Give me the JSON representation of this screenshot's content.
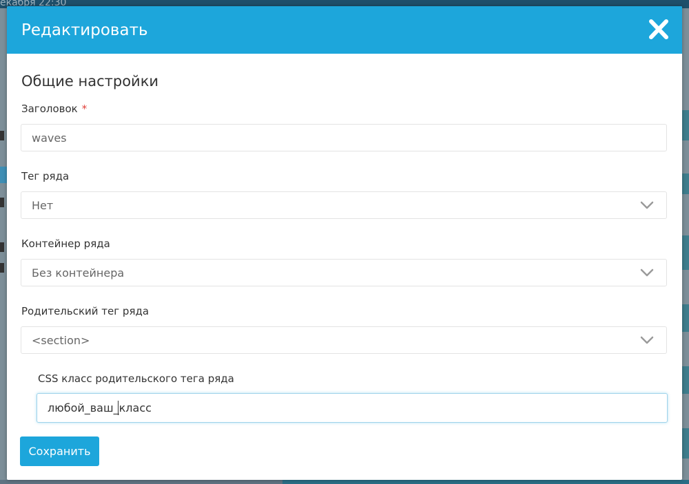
{
  "background": {
    "topbar_text": "екабря 22:30"
  },
  "modal": {
    "title": "Редактировать",
    "close_icon": "close-icon",
    "section_title": "Общие настройки",
    "fields": {
      "title": {
        "label": "Заголовок",
        "required_mark": "*",
        "value": "waves"
      },
      "row_tag": {
        "label": "Тег ряда",
        "selected": "Нет"
      },
      "row_container": {
        "label": "Контейнер ряда",
        "selected": "Без контейнера"
      },
      "parent_tag": {
        "label": "Родительский тег ряда",
        "selected": "<section>"
      },
      "parent_css_class": {
        "label": "CSS класс родительского тега ряда",
        "value": "любой_ваш_класс"
      }
    },
    "save_label": "Сохранить"
  },
  "colors": {
    "header": "#1da6db",
    "button": "#1da6db",
    "required": "#e0403a",
    "overlay": "#6f8796"
  }
}
